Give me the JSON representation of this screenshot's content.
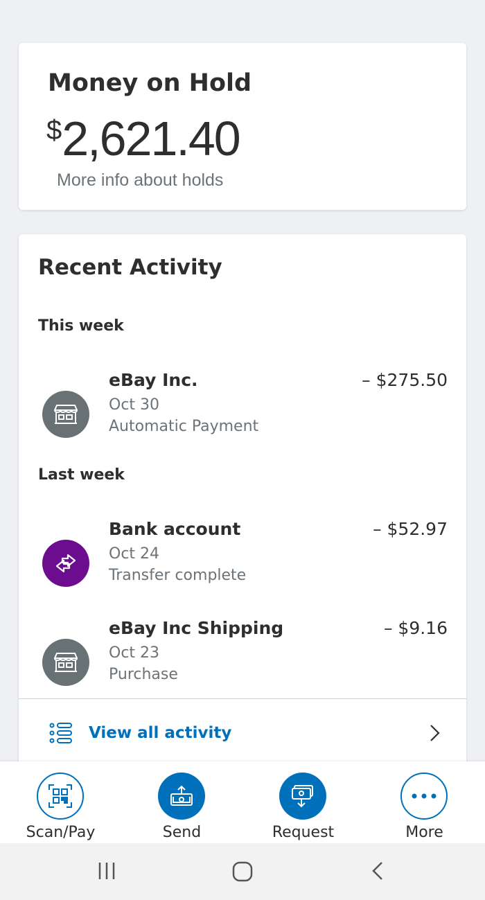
{
  "hold": {
    "title": "Money on Hold",
    "currency": "$",
    "amount": "2,621.40",
    "link": "More info about holds"
  },
  "activity": {
    "title": "Recent Activity",
    "sections": [
      {
        "label": "This week",
        "transactions": [
          {
            "name": "eBay Inc.",
            "date": "Oct 30",
            "type": "Automatic Payment",
            "amount": "– $275.50",
            "icon": "store-icon"
          }
        ]
      },
      {
        "label": "Last week",
        "transactions": [
          {
            "name": "Bank account",
            "date": "Oct 24",
            "type": "Transfer complete",
            "amount": "– $52.97",
            "icon": "transfer-icon"
          },
          {
            "name": "eBay Inc Shipping",
            "date": "Oct 23",
            "type": "Purchase",
            "amount": "– $9.16",
            "icon": "store-icon"
          }
        ]
      }
    ],
    "view_all": "View all activity"
  },
  "nav": {
    "items": [
      {
        "label": "Scan/Pay",
        "icon": "qr-code-icon"
      },
      {
        "label": "Send",
        "icon": "send-money-icon"
      },
      {
        "label": "Request",
        "icon": "request-money-icon"
      },
      {
        "label": "More",
        "icon": "more-dots-icon"
      }
    ]
  },
  "colors": {
    "accent": "#0070ba",
    "purple": "#6c0d8f",
    "gray_avatar": "#687173",
    "background": "#eef0f4"
  }
}
